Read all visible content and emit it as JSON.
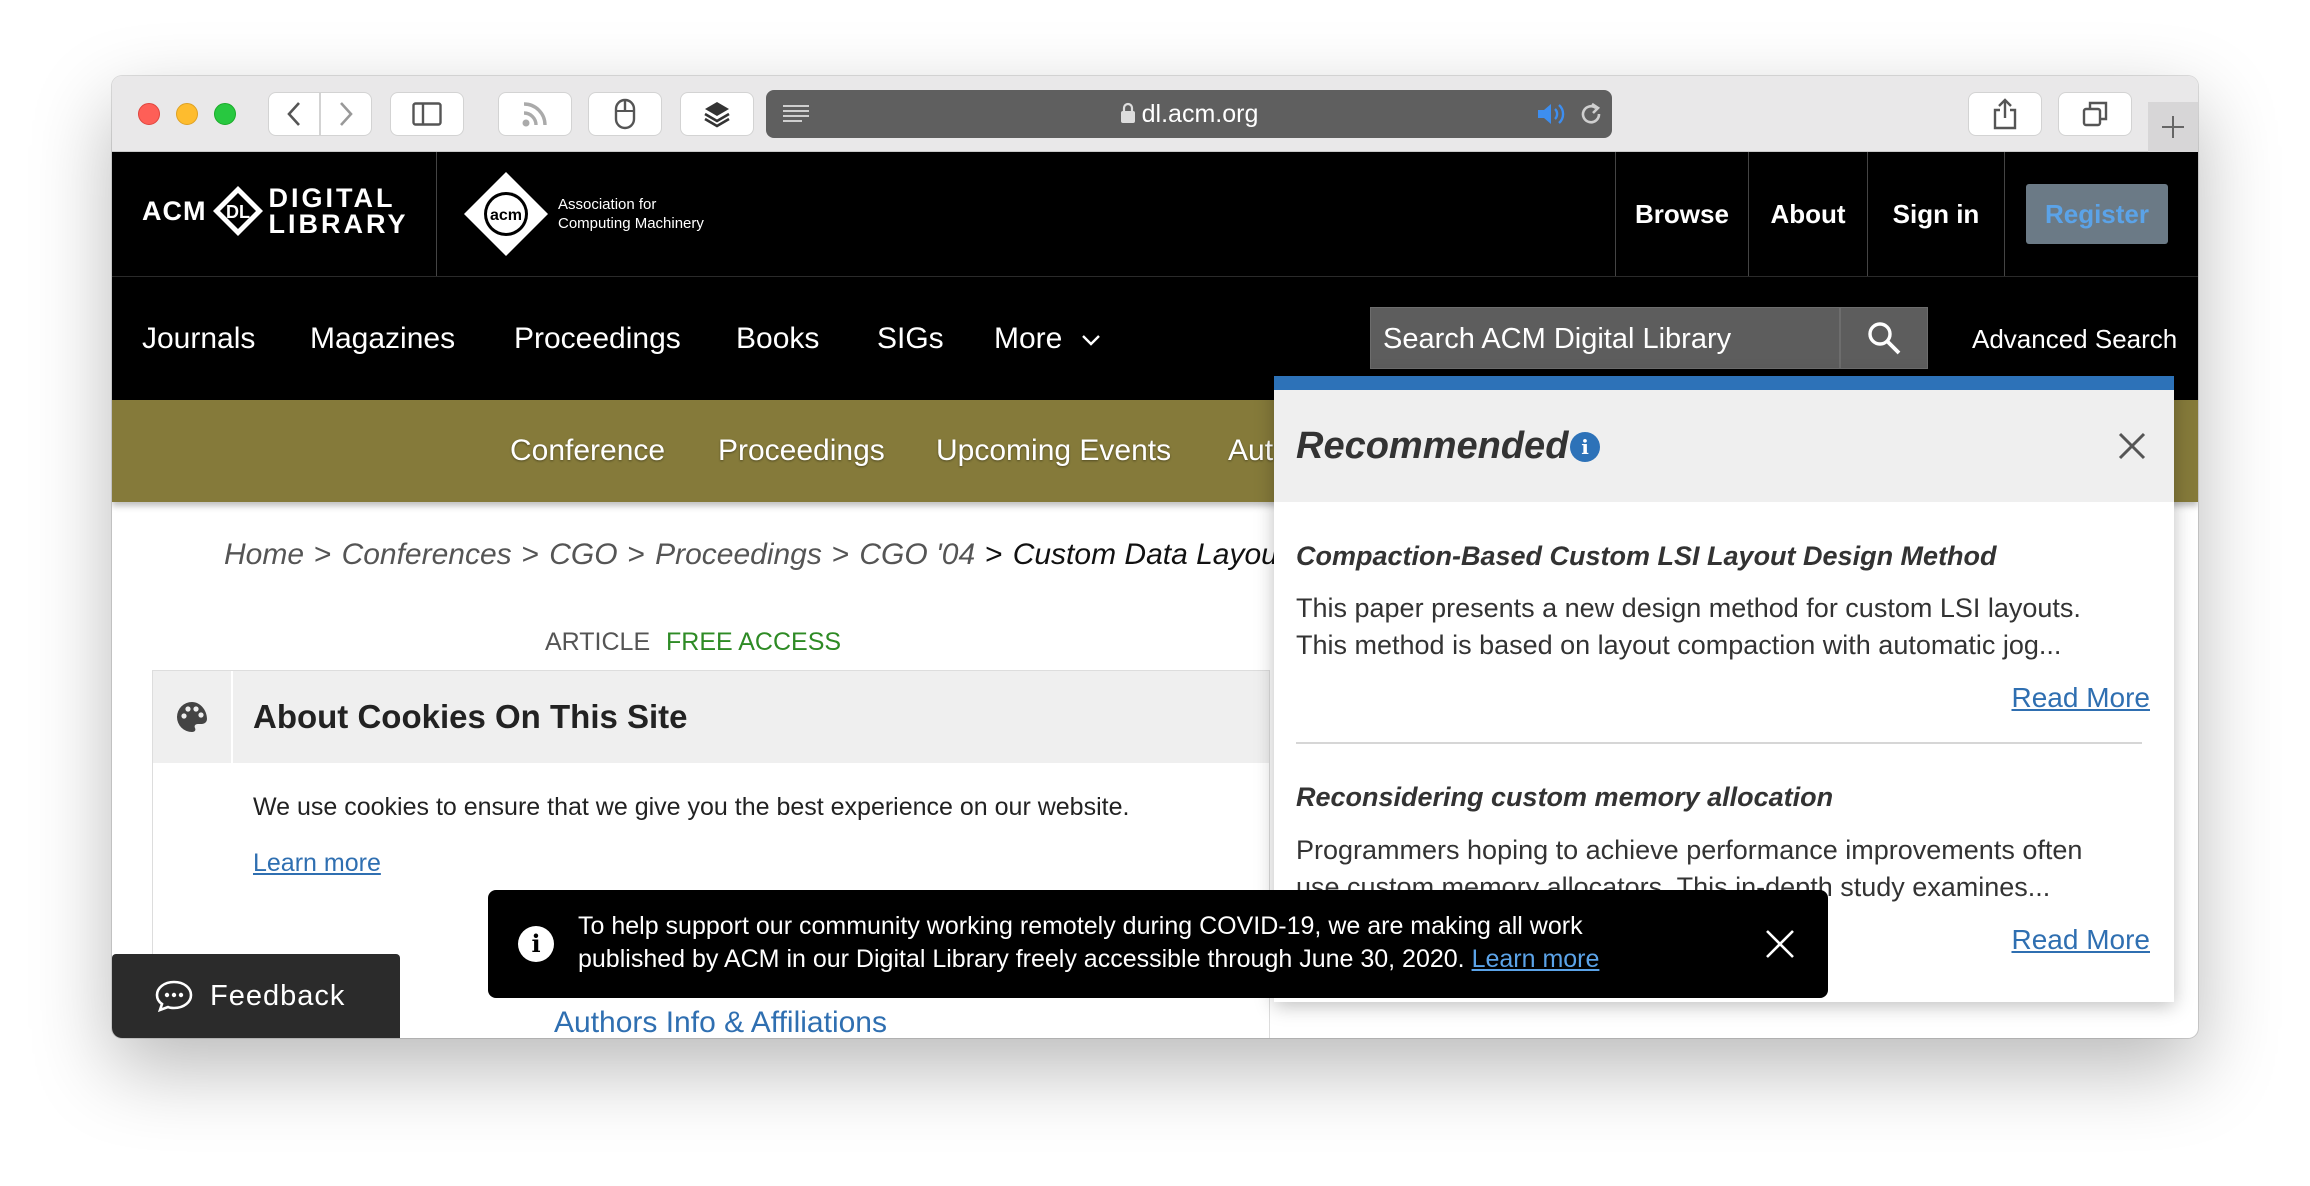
{
  "browser": {
    "url": "dl.acm.org"
  },
  "header": {
    "logo_acm": "ACM",
    "logo_dl_line1": "DIGITAL",
    "logo_dl_line2": "LIBRARY",
    "assoc_line1": "Association for",
    "assoc_line2": "Computing Machinery",
    "links": [
      "Browse",
      "About",
      "Sign in"
    ],
    "register": "Register"
  },
  "nav": {
    "items": [
      "Journals",
      "Magazines",
      "Proceedings",
      "Books",
      "SIGs",
      "More"
    ],
    "search_placeholder": "Search ACM Digital Library",
    "advanced_search": "Advanced Search"
  },
  "conference_bar": {
    "items": [
      "Conference",
      "Proceedings",
      "Upcoming Events",
      "Aut"
    ]
  },
  "breadcrumb": {
    "items": [
      "Home",
      "Conferences",
      "CGO",
      "Proceedings",
      "CGO '04"
    ],
    "current": "Custom Data Layout for M"
  },
  "article": {
    "type": "ARTICLE",
    "access": "FREE ACCESS",
    "authors_link": "Authors Info & Affiliations"
  },
  "cookies": {
    "title": "About Cookies On This Site",
    "body": "We use cookies to ensure that we give you the best experience on our website.",
    "learn_more": "Learn more"
  },
  "feedback": {
    "label": "Feedback"
  },
  "recommended": {
    "title": "Recommended",
    "items": [
      {
        "title": "Compaction-Based Custom LSI Layout Design Method",
        "desc_line1": "This paper presents a new design method for custom LSI layouts.",
        "desc_line2": "This method is based on layout compaction with automatic jog...",
        "read_more": "Read More"
      },
      {
        "title": "Reconsidering custom memory allocation",
        "desc_line1": "Programmers hoping to achieve performance improvements often",
        "desc_line2": "use custom memory allocators. This in-depth study examines...",
        "read_more": "Read More"
      }
    ]
  },
  "covid_banner": {
    "line1": "To help support our community working remotely during COVID-19, we are making all work",
    "line2": "published by ACM in our Digital Library freely accessible through June 30, 2020.",
    "learn_more": "Learn more"
  },
  "colors": {
    "conference_bar": "#857a3a",
    "link_blue": "#2f6fb1",
    "free_access_green": "#2e8b25",
    "recommended_accent": "#2d72b8"
  }
}
